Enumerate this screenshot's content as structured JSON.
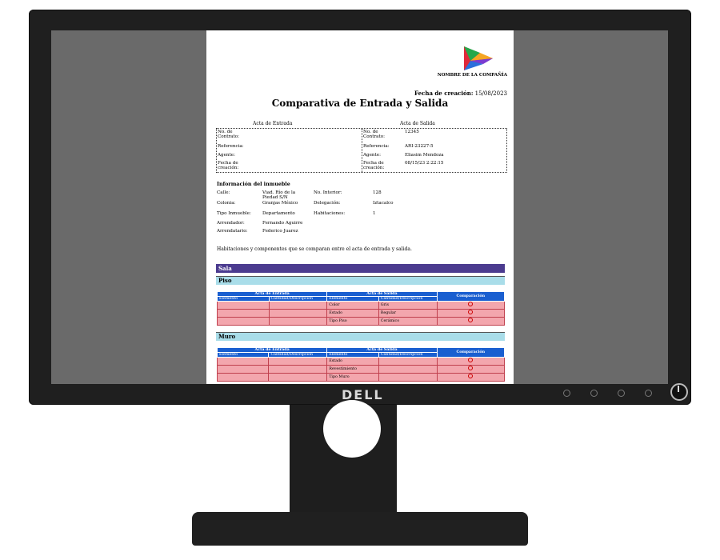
{
  "brand": "DELL",
  "document": {
    "company_name": "NOMBRE DE LA COMPAÑÍA",
    "fecha_label": "Fecha de creación:",
    "fecha_value": "15/08/2023",
    "title": "Comparativa de Entrada y Salida",
    "acta_entrada_label": "Acta de Entrada",
    "acta_salida_label": "Acta de Salida",
    "entrada": {
      "contrato_label": "No. de Contrato:",
      "referencia_label": "Referencia:",
      "agente_label": "Agente:",
      "fecha_label": "Fecha de creación:"
    },
    "salida": {
      "contrato_label": "No. de Contrato:",
      "contrato_value": "12345",
      "referencia_label": "Referencia:",
      "referencia_value": "ARI-23227-5",
      "agente_label": "Agente:",
      "agente_value": "Eliasim Mendoza",
      "fecha_label": "Fecha de creación:",
      "fecha_value": "08/15/23 2:22:15"
    },
    "inmueble": {
      "heading": "Información del inmueble",
      "calle_label": "Calle:",
      "calle_value": "Viad. Río de la Piedad S/N",
      "no_interior_label": "No. Interior:",
      "no_interior_value": "128",
      "colonia_label": "Colonia:",
      "colonia_value": "Granjas México",
      "delegacion_label": "Delegación:",
      "delegacion_value": "Iztacalco",
      "tipo_label": "Tipo Inmueble:",
      "tipo_value": "Departamento",
      "habitaciones_label": "Habitaciones:",
      "habitaciones_value": "1",
      "arrendador_label": "Arrendador:",
      "arrendador_value": "Fernando Aguirre",
      "arrendatario_label": "Arrendatario:",
      "arrendatario_value": "Federico Juarez"
    },
    "note": "Habitaciones y componentes que se comparan entre el acta de entrada y salida.",
    "room": "Sala",
    "table_headers": {
      "entrada": "Acta de Entrada",
      "salida": "Acta de Salida",
      "comparacion": "Comparación",
      "elemento": "Elemento",
      "cantidad": "Cantidad/Descripción"
    },
    "sections": [
      {
        "name": "Piso",
        "rows": [
          {
            "salida_elemento": "Color",
            "salida_desc": "Gris"
          },
          {
            "salida_elemento": "Estado",
            "salida_desc": "Regular"
          },
          {
            "salida_elemento": "Tipo Piso",
            "salida_desc": "Cerámico"
          }
        ]
      },
      {
        "name": "Muro",
        "rows": [
          {
            "salida_elemento": "Estado",
            "salida_desc": ""
          },
          {
            "salida_elemento": "Revestimiento",
            "salida_desc": ""
          },
          {
            "salida_elemento": "Tipo Muro",
            "salida_desc": ""
          }
        ]
      }
    ]
  },
  "colors": {
    "title_bar": "#4b3b8f",
    "section_bar": "#a9dde9",
    "table_header": "#1a5fd0",
    "table_row": "#f3a6ad"
  }
}
